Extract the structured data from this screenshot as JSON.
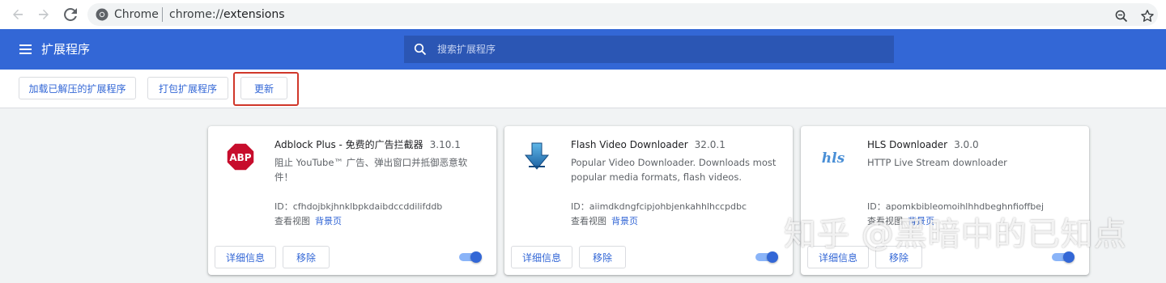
{
  "browser": {
    "site_label": "Chrome",
    "url_scheme": "chrome://",
    "url_host": "extensions"
  },
  "header": {
    "title": "扩展程序",
    "search_placeholder": "搜索扩展程序"
  },
  "toolbar": {
    "load_unpacked_label": "加载已解压的扩展程序",
    "pack_label": "打包扩展程序",
    "update_label": "更新"
  },
  "extensions": [
    {
      "name": "Adblock Plus - 免费的广告拦截器",
      "version": "3.10.1",
      "description": "阻止 YouTube™ 广告、弹出窗口并抵御恶意软件！",
      "id_text": "ID：cfhdojbkjhnklbpkdaibdccddilifddb",
      "inspect_label": "查看视图",
      "background_link": "背景页",
      "details_label": "详细信息",
      "remove_label": "移除",
      "enabled": true,
      "icon": "abp-icon",
      "icon_text": "ABP"
    },
    {
      "name": "Flash Video Downloader",
      "version": "32.0.1",
      "description": "Popular Video Downloader. Downloads most popular media formats, flash videos.",
      "id_text": "ID：aiimdkdngfcipjohbjenkahhlhccpdbc",
      "inspect_label": "查看视图",
      "background_link": "背景页",
      "details_label": "详细信息",
      "remove_label": "移除",
      "enabled": true,
      "icon": "download-arrow-icon"
    },
    {
      "name": "HLS Downloader",
      "version": "3.0.0",
      "description": "HTTP Live Stream downloader",
      "id_text": "ID：apomkbibleomoihlhhdbeghnfioffbej",
      "inspect_label": "查看视图",
      "background_link": "背景页",
      "details_label": "详细信息",
      "remove_label": "移除",
      "enabled": true,
      "icon": "hls-icon",
      "icon_text": "hls"
    }
  ],
  "watermark": "知乎 @黑暗中的已知点",
  "colors": {
    "header_bg": "#3367d6",
    "accent": "#3367d6",
    "highlight_border": "#d0372a"
  }
}
